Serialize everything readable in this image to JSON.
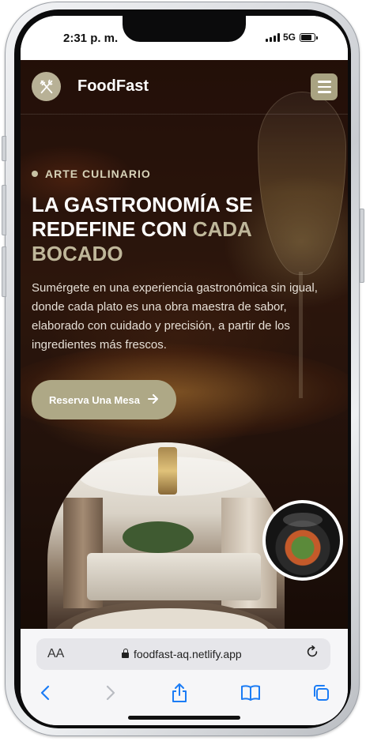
{
  "status_bar": {
    "time": "2:31 p. m.",
    "network": "5G"
  },
  "site": {
    "brand": "FoodFast",
    "hero": {
      "eyebrow": "ARTE CULINARIO",
      "headline_main": "LA GASTRONOMÍA SE REDEFINE CON ",
      "headline_accent": "CADA BOCADO",
      "description": "Sumérgete en una experiencia gastronómica sin igual, donde cada plato es una obra maestra de sabor, elaborado con cuidado y precisión, a partir de los ingredientes más frescos.",
      "cta_label": "Reserva Una Mesa"
    }
  },
  "browser": {
    "text_size_label": "AA",
    "url": "foodfast-aq.netlify.app"
  },
  "colors": {
    "accent": "#aea886",
    "accent_text": "#bfb79a",
    "logo_bg": "#b8b196",
    "safari_blue": "#1b7cf5"
  },
  "icons": {
    "logo": "fork-knife-icon",
    "menu": "hamburger-menu-icon",
    "cta": "arrow-right-icon",
    "lock": "lock-icon",
    "reload": "reload-icon",
    "toolbar": [
      "back-icon",
      "forward-icon",
      "share-icon",
      "bookmarks-icon",
      "tabs-icon"
    ]
  }
}
